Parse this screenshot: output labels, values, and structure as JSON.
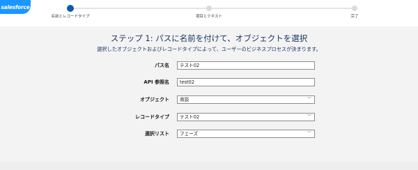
{
  "brand": {
    "logo_text": "salesforce"
  },
  "progress": {
    "current_step": 1,
    "steps": [
      {
        "label": "名前とレコードタイプ"
      },
      {
        "label": "項目とテキスト"
      },
      {
        "label": "完了"
      }
    ]
  },
  "header": {
    "title": "ステップ 1: パスに名前を付けて、オブジェクトを選択",
    "subtitle": "選択したオブジェクトおよびレコードタイプによって、ユーザーのビジネスプロセスが決まります。"
  },
  "form": {
    "path_name": {
      "label": "パス名",
      "value": "テスト02"
    },
    "api_name": {
      "label": "API 参照名",
      "value": "test02"
    },
    "object": {
      "label": "オブジェクト",
      "value": "商談"
    },
    "record_type": {
      "label": "レコードタイプ",
      "value": "テスト02"
    },
    "picklist": {
      "label": "選択リスト",
      "value": "フェーズ"
    }
  },
  "colors": {
    "accent": "#0b5cab",
    "brand": "#1b96ff"
  }
}
